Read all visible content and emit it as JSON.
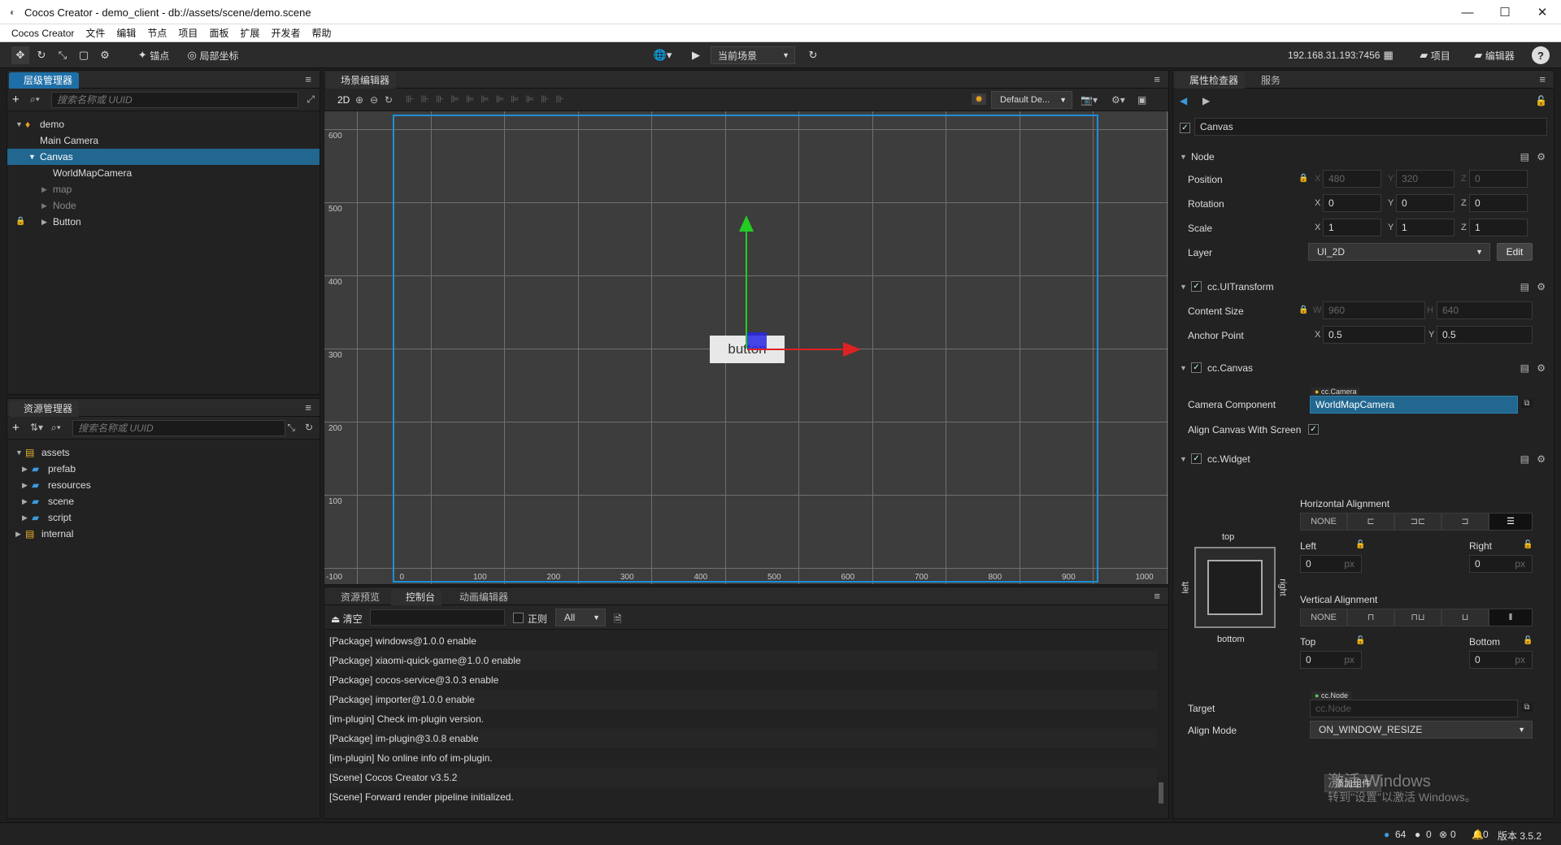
{
  "window": {
    "title": "Cocos Creator - demo_client - db://assets/scene/demo.scene",
    "min": "—",
    "max": "☐",
    "close": "✕"
  },
  "menu": [
    "Cocos Creator",
    "文件",
    "编辑",
    "节点",
    "项目",
    "面板",
    "扩展",
    "开发者",
    "帮助"
  ],
  "toolbar": {
    "pivot_label": "锚点",
    "local_label": "局部坐标",
    "scene_select": "当前场景",
    "ip": "192.168.31.193:7456",
    "project_btn": "项目",
    "editor_btn": "编辑器",
    "help": "?"
  },
  "hierarchy": {
    "tab": "层级管理器",
    "search_placeholder": "搜索名称或 UUID",
    "nodes": [
      {
        "label": "demo",
        "state": "normal"
      },
      {
        "label": "Main Camera",
        "state": "normal"
      },
      {
        "label": "Canvas",
        "state": "selected"
      },
      {
        "label": "WorldMapCamera",
        "state": "normal"
      },
      {
        "label": "map",
        "state": "dim"
      },
      {
        "label": "Node",
        "state": "dim"
      },
      {
        "label": "Button",
        "state": "normal"
      }
    ]
  },
  "assets": {
    "tab": "资源管理器",
    "search_placeholder": "搜索名称或 UUID",
    "items": [
      "assets",
      "prefab",
      "resources",
      "scene",
      "script",
      "internal"
    ]
  },
  "scene_editor": {
    "tab": "场景编辑器",
    "mode_2d": "2D",
    "layout_select": "Default De...",
    "y_ticks": [
      "600",
      "500",
      "400",
      "300",
      "200",
      "100"
    ],
    "x_ticks": [
      "-100",
      "0",
      "100",
      "200",
      "300",
      "400",
      "500",
      "600",
      "700",
      "800",
      "900",
      "1000"
    ],
    "button_text": "button"
  },
  "console": {
    "tabs": [
      "资源预览",
      "控制台",
      "动画编辑器"
    ],
    "clear": "清空",
    "regex": "正则",
    "filter": "All",
    "logs": [
      "[Package] windows@1.0.0 enable",
      "[Package] xiaomi-quick-game@1.0.0 enable",
      "[Package] cocos-service@3.0.3 enable",
      "[Package] importer@1.0.0 enable",
      "[im-plugin] Check im-plugin version.",
      "[Package] im-plugin@3.0.8 enable",
      "[im-plugin] No online info of im-plugin.",
      "[Scene] Cocos Creator v3.5.2",
      "[Scene] Forward render pipeline initialized."
    ]
  },
  "inspector": {
    "tabs": [
      "属性检查器",
      "服务"
    ],
    "node_name": "Canvas",
    "node_section": "Node",
    "position": {
      "label": "Position",
      "x": "480",
      "y": "320",
      "z": "0"
    },
    "rotation": {
      "label": "Rotation",
      "x": "0",
      "y": "0",
      "z": "0"
    },
    "scale": {
      "label": "Scale",
      "x": "1",
      "y": "1",
      "z": "1"
    },
    "layer": {
      "label": "Layer",
      "value": "UI_2D",
      "edit": "Edit"
    },
    "uitransform": {
      "title": "cc.UITransform",
      "content_size": "Content Size",
      "w": "960",
      "h": "640",
      "anchor": "Anchor Point",
      "ax": "0.5",
      "ay": "0.5"
    },
    "canvas": {
      "title": "cc.Canvas",
      "camera_label": "Camera Component",
      "camera_type": "cc.Camera",
      "camera_value": "WorldMapCamera",
      "align_label": "Align Canvas With Screen"
    },
    "widget": {
      "title": "cc.Widget",
      "h_align": "Horizontal Alignment",
      "v_align": "Vertical Alignment",
      "none": "NONE",
      "left": "Left",
      "right": "Right",
      "top": "Top",
      "bottom": "Bottom",
      "left_val": "0",
      "right_val": "0",
      "top_val": "0",
      "bottom_val": "0",
      "unit": "px",
      "box_top": "top",
      "box_bottom": "bottom",
      "box_left": "left",
      "box_right": "right",
      "target_label": "Target",
      "target_type": "cc.Node",
      "target_placeholder": "cc.Node",
      "align_mode_label": "Align Mode",
      "align_mode": "ON_WINDOW_RESIZE"
    },
    "axis": {
      "x": "X",
      "y": "Y",
      "z": "Z",
      "w": "W",
      "h": "H"
    },
    "add_component": "添加组件",
    "watermark1": "激活 Windows",
    "watermark2": "转到\"设置\"以激活 Windows。"
  },
  "status": {
    "info": "64",
    "warn": "0",
    "err": "0",
    "notice": "0",
    "version": "版本 3.5.2"
  },
  "colors": {
    "accent": "#1e6fa7",
    "selected_row": "#21678f"
  }
}
